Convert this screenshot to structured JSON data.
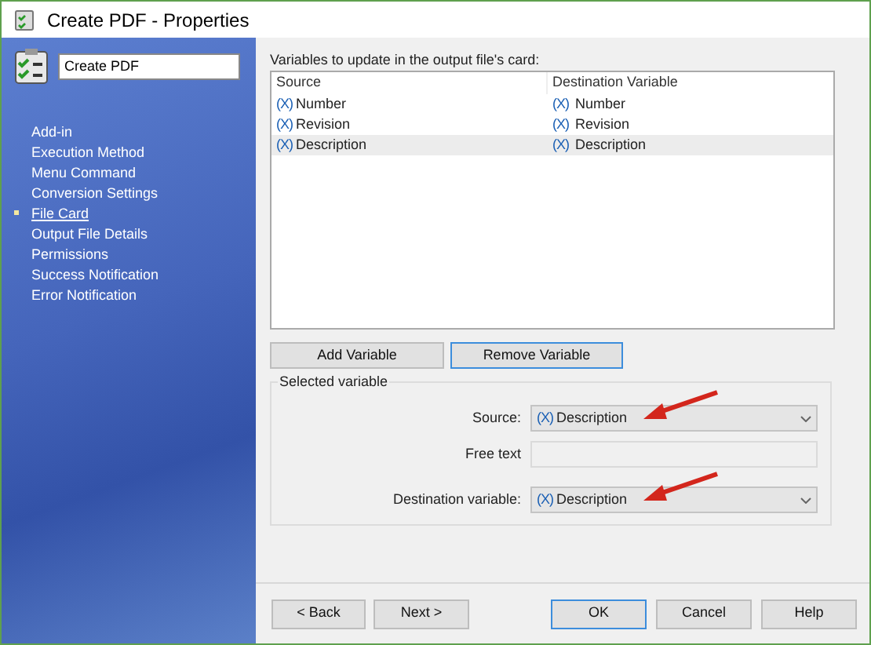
{
  "window": {
    "title": "Create PDF - Properties"
  },
  "sidebar": {
    "name_field": {
      "value": "Create PDF"
    },
    "items": [
      {
        "label": "Add-in",
        "selected": false
      },
      {
        "label": "Execution Method",
        "selected": false
      },
      {
        "label": "Menu Command",
        "selected": false
      },
      {
        "label": "Conversion Settings",
        "selected": false
      },
      {
        "label": "File Card",
        "selected": true
      },
      {
        "label": "Output File Details",
        "selected": false
      },
      {
        "label": "Permissions",
        "selected": false
      },
      {
        "label": "Success Notification",
        "selected": false
      },
      {
        "label": "Error Notification",
        "selected": false
      }
    ]
  },
  "variables": {
    "caption": "Variables to update in the output file's card:",
    "columns": [
      "Source",
      "Destination Variable"
    ],
    "rows": [
      {
        "source": {
          "symbol": "(X)",
          "text": "Number"
        },
        "destination": {
          "symbol": "(X)",
          "text": "Number"
        },
        "selected": false
      },
      {
        "source": {
          "symbol": "(X)",
          "text": "Revision"
        },
        "destination": {
          "symbol": "(X)",
          "text": "Revision"
        },
        "selected": false
      },
      {
        "source": {
          "symbol": "(X)",
          "text": "Description"
        },
        "destination": {
          "symbol": "(X)",
          "text": "Description"
        },
        "selected": true
      }
    ]
  },
  "list_buttons": [
    {
      "label": "Add Variable",
      "focused": false
    },
    {
      "label": "Remove Variable",
      "focused": true
    }
  ],
  "selected_variable": {
    "title": "Selected variable",
    "fields": [
      {
        "kind": "combo",
        "label": "Source:",
        "symbol": "(X)",
        "value": "Description",
        "annotated": true
      },
      {
        "kind": "text",
        "label": "Free text",
        "annotated": false
      },
      {
        "kind": "combo",
        "label": "Destination variable:",
        "symbol": "(X)",
        "value": "Description",
        "annotated": true
      }
    ]
  },
  "footer_buttons": [
    {
      "label": "< Back",
      "focused": false
    },
    {
      "label": "Next >",
      "focused": false
    },
    {
      "label": "OK",
      "focused": true
    },
    {
      "label": "Cancel",
      "focused": false
    },
    {
      "label": "Help",
      "focused": false
    }
  ]
}
